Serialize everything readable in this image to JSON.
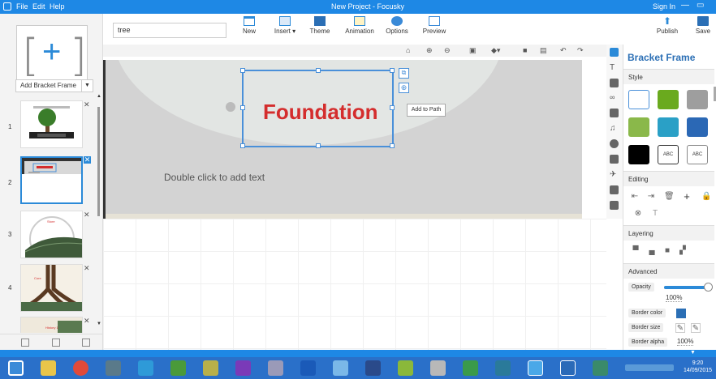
{
  "titlebar": {
    "menu_file": "File",
    "menu_edit": "Edit",
    "menu_help": "Help",
    "title": "New Project - Focusky",
    "signin": "Sign In",
    "minimize": "—",
    "maximize": "▭"
  },
  "left": {
    "add_frame_label": "Add Bracket Frame",
    "slides": [
      {
        "num": "1"
      },
      {
        "num": "2"
      },
      {
        "num": "3"
      },
      {
        "num": "4"
      }
    ],
    "thumb3_title": "Store",
    "thumb4_title": "Core",
    "thumb5_title": "History 1"
  },
  "toolbar": {
    "search_value": "tree",
    "new": "New",
    "insert": "Insert ▾",
    "theme": "Theme",
    "animation": "Animation",
    "options": "Options",
    "preview": "Preview",
    "publish": "Publish",
    "save": "Save"
  },
  "canvas": {
    "foundation_text": "Foundation",
    "double_click_text": "Double click to add text",
    "add_to_path_tooltip": "Add to Path"
  },
  "right": {
    "panel_title": "Bracket Frame",
    "style_section": "Style",
    "editing_section": "Editing",
    "layering_section": "Layering",
    "advanced_section": "Advanced",
    "swatch_text": "ABC",
    "opacity_label": "Opacity",
    "opacity_value": "100%",
    "border_color_label": "Border color",
    "border_size_label": "Border size",
    "border_alpha_label": "Border alpha",
    "border_alpha_value": "100%",
    "opacity_level": 1.0
  },
  "taskbar": {
    "time": "9:20",
    "date": "14/09/2015"
  },
  "colors": {
    "accent": "#1e88e5",
    "frame_blue": "#4a90d9",
    "foundation_red": "#d42d2d",
    "swatch_green": "#6aaa1e",
    "swatch_gray": "#9e9e9e",
    "swatch_lightgreen": "#8ab84a",
    "swatch_teal": "#2aa0c6",
    "swatch_blue": "#2b68b5",
    "swatch_black": "#000000"
  }
}
